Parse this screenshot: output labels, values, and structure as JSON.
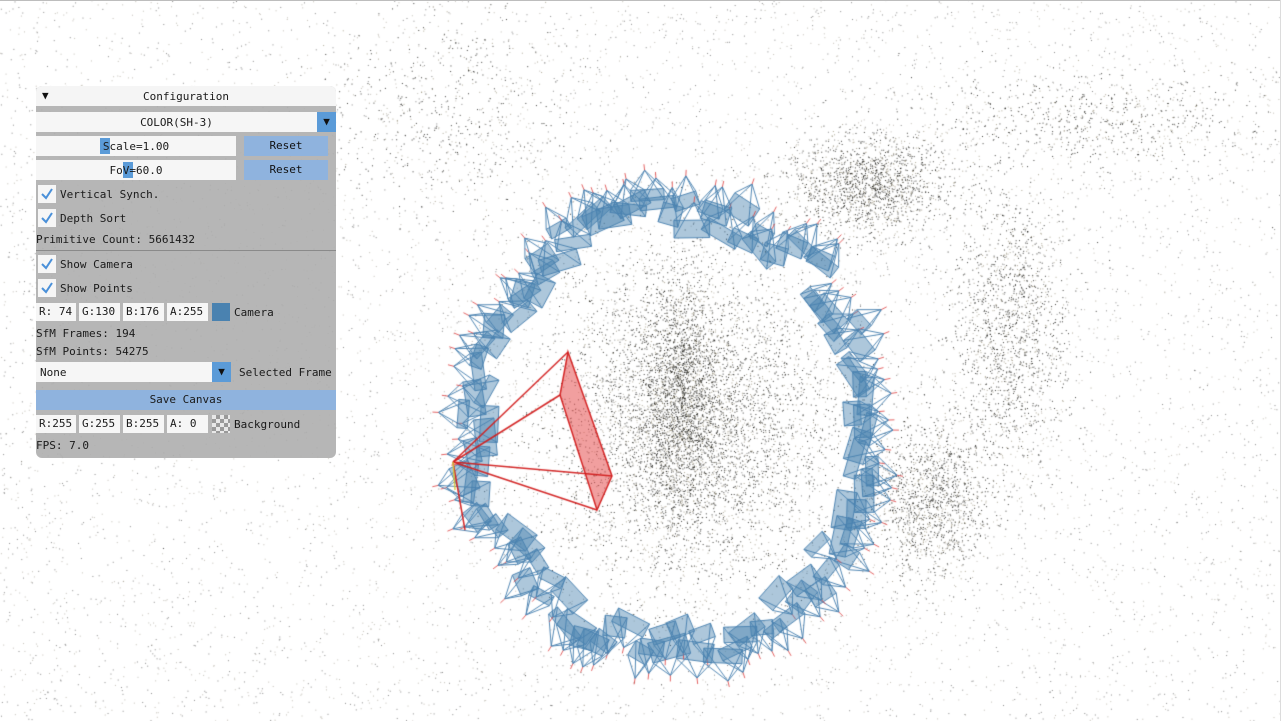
{
  "panel": {
    "title": "Configuration",
    "render_mode": "COLOR(SH-3)",
    "scale_label": "Scale=1.00",
    "fov_label": "FoV=60.0",
    "reset_label": "Reset",
    "vsync_label": "Vertical Synch.",
    "vsync_checked": true,
    "depth_sort_label": "Depth Sort",
    "depth_sort_checked": true,
    "primitive_count": "Primitive Count: 5661432",
    "show_camera_label": "Show Camera",
    "show_camera_checked": true,
    "show_points_label": "Show Points",
    "show_points_checked": true,
    "camera_color": {
      "r": "R: 74",
      "g": "G:130",
      "b": "B:176",
      "a": "A:255",
      "label": "Camera",
      "hex": "#4a82b0"
    },
    "sfm_frames": "SfM Frames: 194",
    "sfm_points": "SfM Points: 54275",
    "selected_frame_value": "None",
    "selected_frame_label": "Selected Frame",
    "save_canvas_label": "Save Canvas",
    "background_color": {
      "r": "R:255",
      "g": "G:255",
      "b": "B:255",
      "a": "A:  0",
      "label": "Background"
    },
    "fps": "FPS: 7.0"
  },
  "colors": {
    "accent": "#5b9bd8",
    "button": "#8fb3de",
    "panel_bg": "#acacac",
    "camera_frustum": "#4a82b0",
    "selected_frustum": "#d22020"
  },
  "icons": {
    "collapse": "triangle-down-icon",
    "combo": "chevron-down-icon",
    "check": "checkmark-icon"
  }
}
